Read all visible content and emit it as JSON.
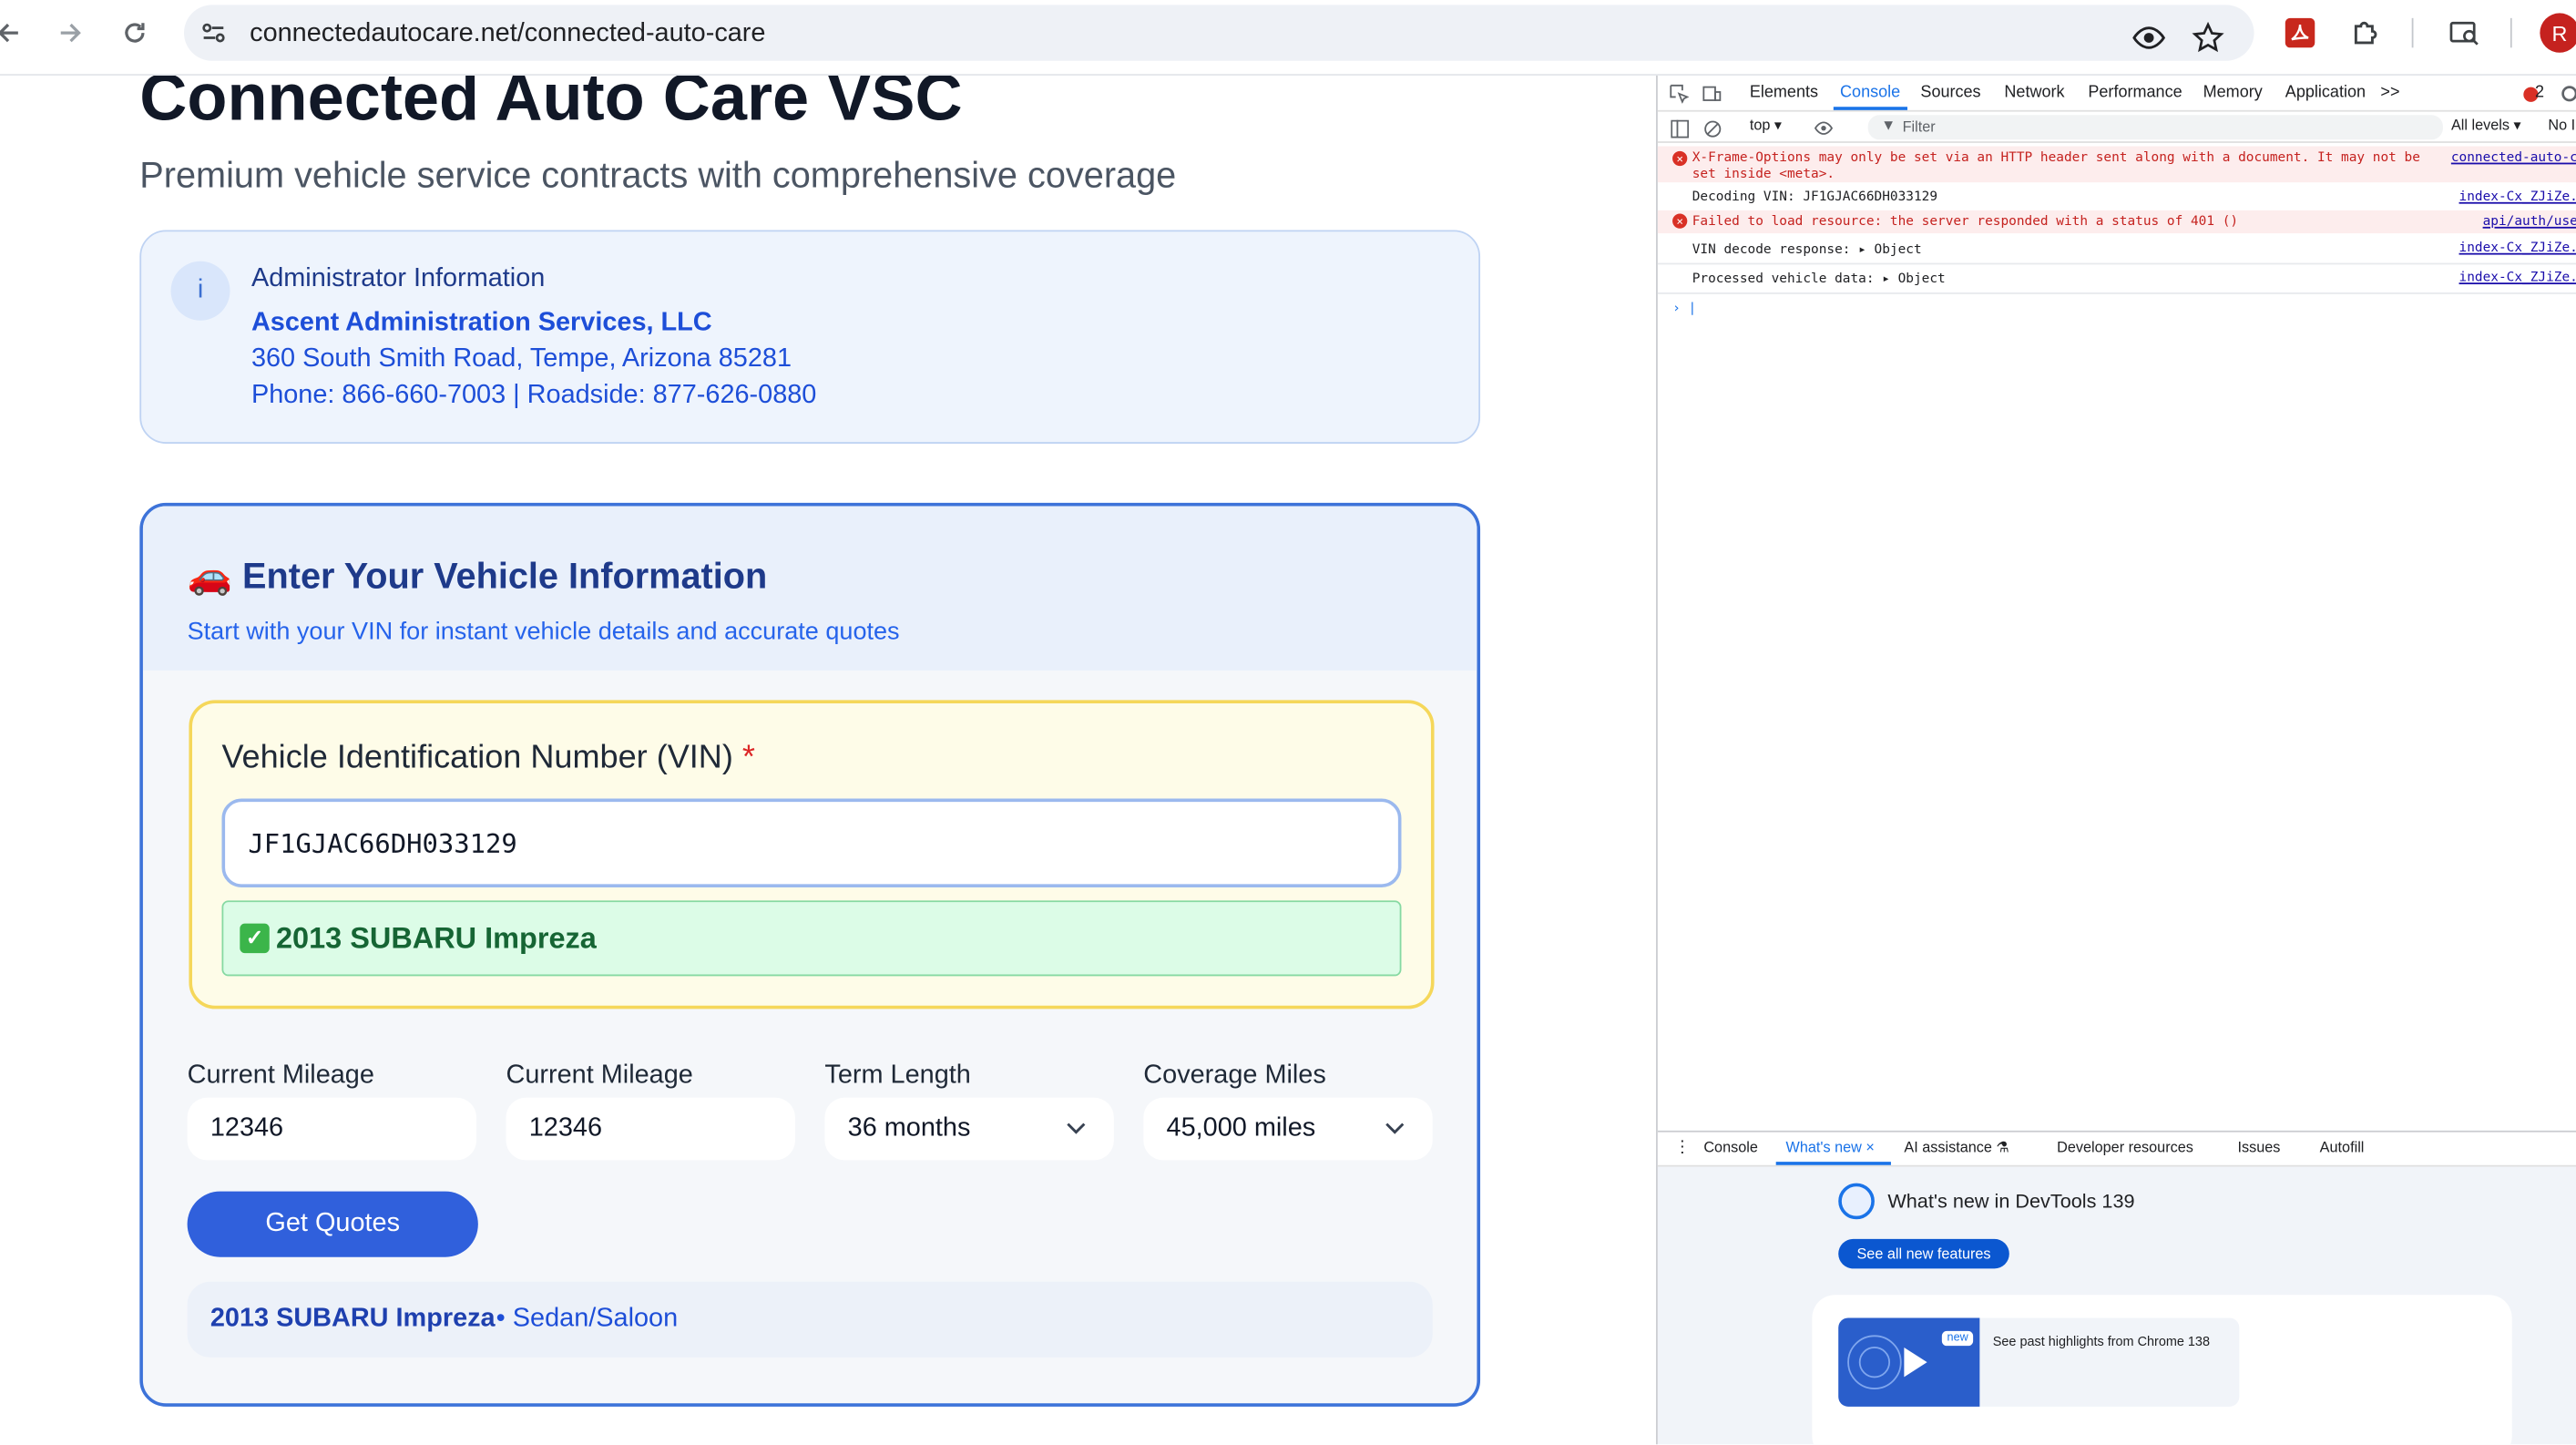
{
  "browser": {
    "url": "connectedautocare.net/connected-auto-care",
    "profile_initial": "R"
  },
  "page": {
    "title": "Connected Auto Care VSC",
    "subtitle": "Premium vehicle service contracts with comprehensive coverage"
  },
  "admin": {
    "icon_glyph": "i",
    "heading": "Administrator Information",
    "name": "Ascent Administration Services, LLC",
    "address": "360 South Smith Road, Tempe, Arizona 85281",
    "phones": "Phone: 866-660-7003 | Roadside: 877-626-0880"
  },
  "vehicle_form": {
    "title": "🚗 Enter Your Vehicle Information",
    "subtitle": "Start with your VIN for instant vehicle details and accurate quotes",
    "vin_label": "Vehicle Identification Number (VIN)",
    "vin_required_mark": "*",
    "vin_value": "JF1GJAC66DH033129",
    "vin_result_check": "✓",
    "vin_result": "2013 SUBARU Impreza",
    "fields": [
      {
        "label": "Current Mileage",
        "value": "12346"
      },
      {
        "label": "Current Mileage",
        "value": "12346"
      },
      {
        "label": "Term Length",
        "value": "36 months"
      },
      {
        "label": "Coverage Miles",
        "value": "45,000 miles"
      }
    ],
    "get_quotes_label": "Get Quotes",
    "summary_name": "2013 SUBARU Impreza",
    "summary_body": "• Sedan/Saloon"
  },
  "devtools": {
    "tabs": [
      "Elements",
      "Console",
      "Sources",
      "Network",
      "Performance",
      "Memory",
      "Application",
      ">>"
    ],
    "active_tab": "Console",
    "error_count": "2",
    "context": "top ▾",
    "filter_placeholder": "Filter",
    "levels": "All levels ▾",
    "levels_extra": "No I",
    "logs": [
      {
        "type": "error",
        "text": "X-Frame-Options may only be set via an HTTP header sent along with a document. It may not be",
        "text2": "set inside <meta>.",
        "source": "connected-auto-c"
      },
      {
        "type": "log",
        "text": "Decoding VIN: JF1GJAC66DH033129",
        "source": "index-Cx_ZJiZe."
      },
      {
        "type": "error",
        "text": "Failed to load resource: the server responded with a status of 401 ()",
        "source": "api/auth/use"
      },
      {
        "type": "log",
        "text": "VIN decode response:  ▸ Object",
        "source": "index-Cx_ZJiZe."
      },
      {
        "type": "log",
        "text": "Processed vehicle data:  ▸ Object",
        "source": "index-Cx_ZJiZe."
      }
    ],
    "prompt": "› |",
    "drawer_tabs": [
      "Console",
      "What's new ×",
      "AI assistance ⚗",
      "Developer resources",
      "Issues",
      "Autofill"
    ],
    "drawer_active": "What's new ×",
    "whats_new_title": "What's new in DevTools 139",
    "see_all_label": "See all new features",
    "new_badge": "new",
    "past_highlights": "See past highlights from Chrome 138"
  }
}
